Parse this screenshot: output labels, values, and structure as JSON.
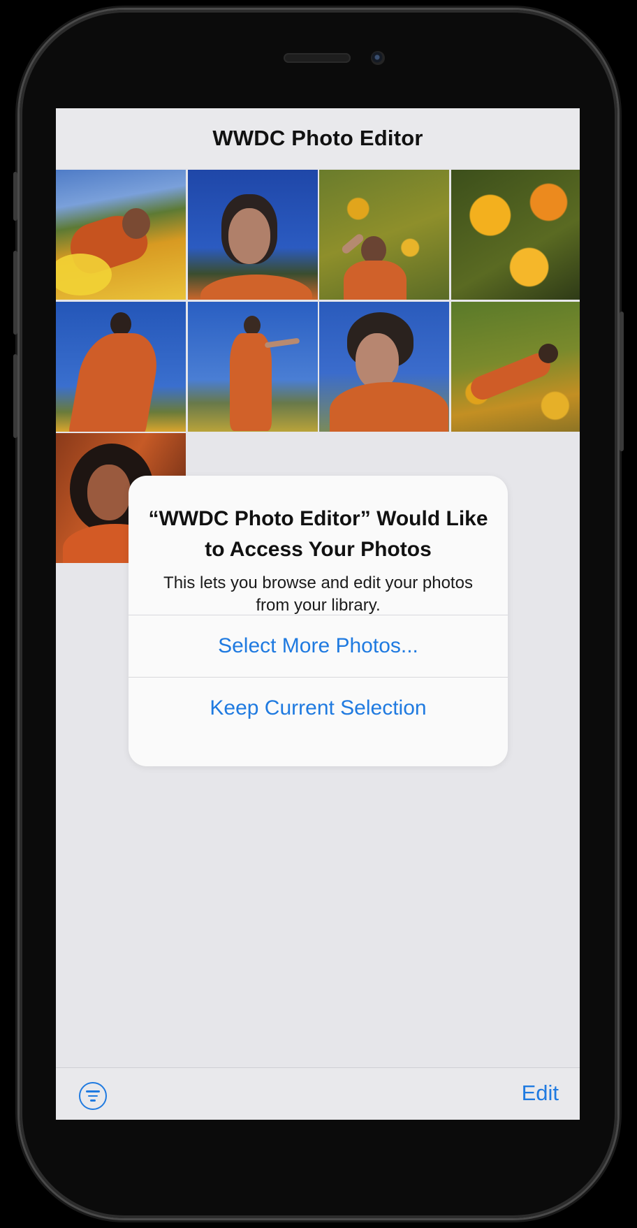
{
  "navbar": {
    "title": "WWDC Photo Editor"
  },
  "photos": [
    {
      "name": "photo-woman-lying-in-flowers"
    },
    {
      "name": "photo-woman-smiling-blue-sky"
    },
    {
      "name": "photo-woman-shading-eyes-in-field"
    },
    {
      "name": "photo-yellow-orange-flowers"
    },
    {
      "name": "photo-woman-in-orange-dress-low-angle"
    },
    {
      "name": "photo-woman-in-orange-dress-hillside"
    },
    {
      "name": "photo-woman-short-hair-portrait"
    },
    {
      "name": "photo-woman-lying-on-hillside"
    },
    {
      "name": "photo-woman-curly-hair-portrait"
    }
  ],
  "alert": {
    "title": "“WWDC Photo Editor” Would Like to Access Your Photos",
    "message": "This lets you browse and edit your photos from your library.",
    "buttons": [
      "Select More Photos...",
      "Keep Current Selection"
    ]
  },
  "toolbar": {
    "filter_icon": "filter-circle-icon",
    "edit_label": "Edit"
  },
  "colors": {
    "accent": "#1f7ae0",
    "background": "#e6e6ea",
    "alert_background": "#fafafa"
  }
}
